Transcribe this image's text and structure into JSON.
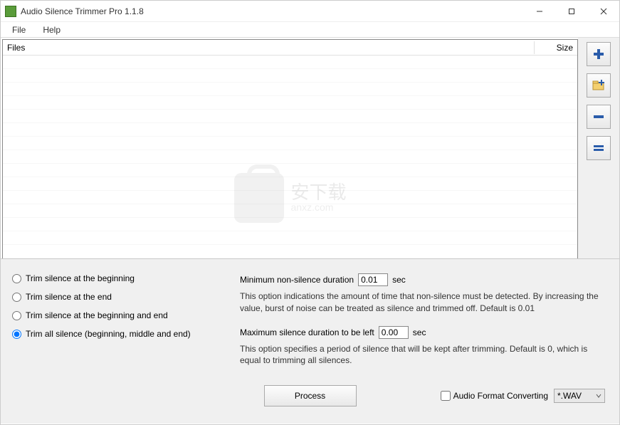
{
  "window": {
    "title": "Audio Silence Trimmer Pro 1.1.8"
  },
  "menu": {
    "file": "File",
    "help": "Help"
  },
  "filelist": {
    "col_files": "Files",
    "col_size": "Size"
  },
  "watermark": {
    "text": "安下载",
    "sub": "anxz.com"
  },
  "sidebuttons": {
    "add": "add-file",
    "add_folder": "add-folder",
    "remove": "remove",
    "remove_all": "remove-all"
  },
  "options": {
    "radio1": "Trim silence at the beginning",
    "radio2": "Trim silence at the end",
    "radio3": "Trim silence at the beginning and end",
    "radio4": "Trim all silence (beginning, middle and end)",
    "min_label": "Minimum non-silence duration",
    "min_value": "0.01",
    "sec": "sec",
    "min_desc": "This option indications the amount of time that non-silence must be detected. By increasing the value, burst of noise can be treated as silence and trimmed off. Default is 0.01",
    "max_label": "Maximum silence duration to be left",
    "max_value": "0.00",
    "max_desc": "This option specifies a period of silence that will be kept after trimming. Default is 0, which is equal to trimming all silences."
  },
  "bottom": {
    "process": "Process",
    "format_chk": "Audio Format Converting",
    "format_sel": "*.WAV"
  }
}
